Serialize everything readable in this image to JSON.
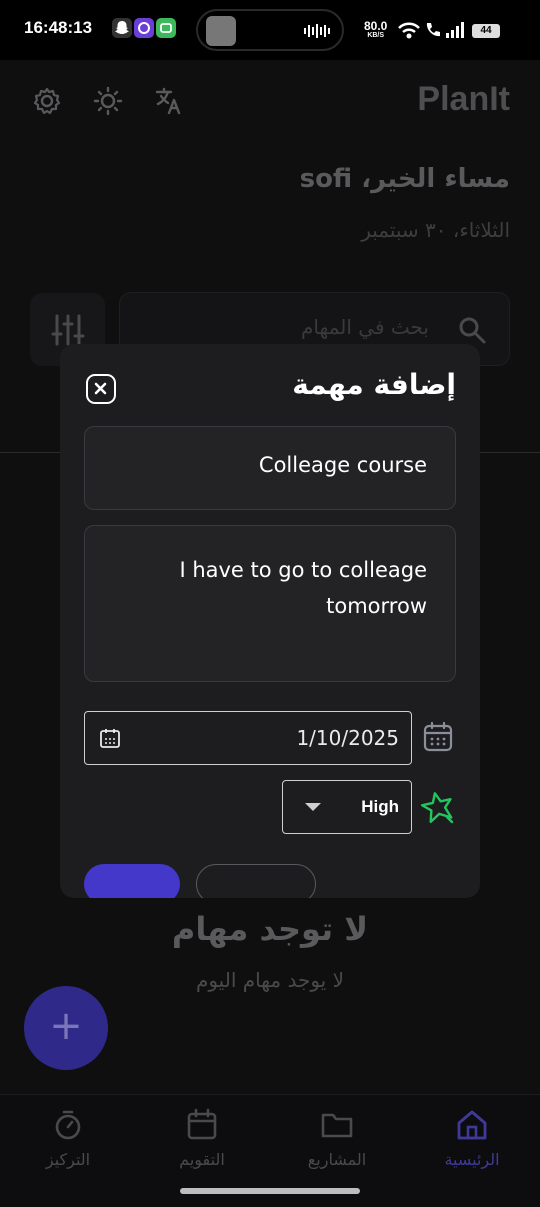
{
  "status_bar": {
    "time": "16:48:13",
    "net_speed_value": "80.0",
    "net_speed_unit": "KB/S",
    "battery": "44"
  },
  "header": {
    "app_title": "PlanIt",
    "greeting": "مساء الخير، sofi",
    "date": "الثلاثاء، ٣٠ سبتمبر",
    "icons": [
      "settings-icon",
      "brightness-icon",
      "translate-icon"
    ]
  },
  "search": {
    "placeholder": "بحث في المهام"
  },
  "empty_state": {
    "title": "لا توجد مهام",
    "subtitle": "لا يوجد مهام اليوم"
  },
  "fab": {
    "label": "+"
  },
  "bottom_nav": {
    "items": [
      {
        "label": "التركيز",
        "icon": "timer-icon"
      },
      {
        "label": "التقويم",
        "icon": "calendar-icon"
      },
      {
        "label": "المشاريع",
        "icon": "folder-icon"
      },
      {
        "label": "الرئيسية",
        "icon": "home-icon",
        "active": true
      }
    ]
  },
  "dialog": {
    "title": "إضافة مهمة",
    "task_title_value": "Colleage course",
    "task_description_value": "I have to go to colleage tomorrow",
    "due_date_value": "1/10/2025",
    "priority_value": "High"
  },
  "colors": {
    "accent": "#4338ca",
    "priority_high": "#22c55e",
    "dialog_bg": "#1d1d20"
  }
}
